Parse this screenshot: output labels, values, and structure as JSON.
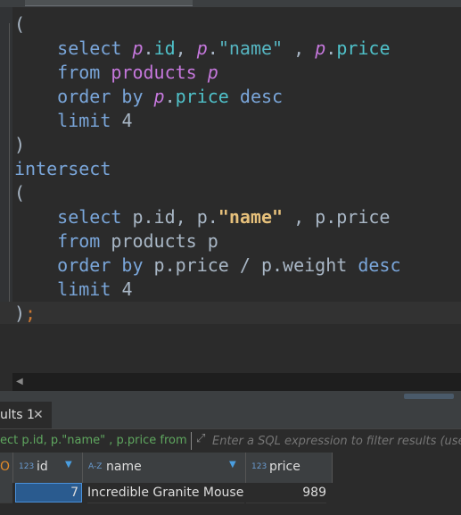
{
  "editor": {
    "lines": [
      {
        "parts": [
          [
            "plain",
            "("
          ]
        ]
      },
      {
        "parts": [
          [
            "plain",
            "    "
          ],
          [
            "kw",
            "select"
          ],
          [
            "plain",
            " "
          ],
          [
            "alias-i",
            "p"
          ],
          [
            "plain",
            "."
          ],
          [
            "fld",
            "id"
          ],
          [
            "plain",
            ", "
          ],
          [
            "alias-i",
            "p"
          ],
          [
            "plain",
            "."
          ],
          [
            "str",
            "\"name\""
          ],
          [
            "plain",
            " , "
          ],
          [
            "alias-i",
            "p"
          ],
          [
            "plain",
            "."
          ],
          [
            "fld",
            "price"
          ]
        ]
      },
      {
        "parts": [
          [
            "plain",
            "    "
          ],
          [
            "kw",
            "from"
          ],
          [
            "plain",
            " "
          ],
          [
            "tbl",
            "products"
          ],
          [
            "plain",
            " "
          ],
          [
            "alias-i",
            "p"
          ]
        ]
      },
      {
        "parts": [
          [
            "plain",
            "    "
          ],
          [
            "kw",
            "order by"
          ],
          [
            "plain",
            " "
          ],
          [
            "alias-i",
            "p"
          ],
          [
            "plain",
            "."
          ],
          [
            "fld",
            "price"
          ],
          [
            "plain",
            " "
          ],
          [
            "kw",
            "desc"
          ]
        ]
      },
      {
        "parts": [
          [
            "plain",
            "    "
          ],
          [
            "kw",
            "limit"
          ],
          [
            "plain",
            " "
          ],
          [
            "num",
            "4"
          ]
        ]
      },
      {
        "parts": [
          [
            "plain",
            ")"
          ]
        ]
      },
      {
        "parts": [
          [
            "kw",
            "intersect"
          ]
        ]
      },
      {
        "parts": [
          [
            "plain",
            "("
          ]
        ]
      },
      {
        "parts": [
          [
            "plain",
            "    "
          ],
          [
            "kw",
            "select"
          ],
          [
            "plain",
            " p.id, p."
          ],
          [
            "str2",
            "\"name\""
          ],
          [
            "plain",
            " , p.price"
          ]
        ]
      },
      {
        "parts": [
          [
            "plain",
            "    "
          ],
          [
            "kw",
            "from"
          ],
          [
            "plain",
            " products p"
          ]
        ]
      },
      {
        "parts": [
          [
            "plain",
            "    "
          ],
          [
            "kw",
            "order by"
          ],
          [
            "plain",
            " p.price / p.weight "
          ],
          [
            "kw",
            "desc"
          ]
        ]
      },
      {
        "parts": [
          [
            "plain",
            "    "
          ],
          [
            "kw",
            "limit"
          ],
          [
            "plain",
            " "
          ],
          [
            "num",
            "4"
          ]
        ]
      },
      {
        "parts": [
          [
            "plain",
            ")"
          ],
          [
            "semi",
            ";"
          ]
        ],
        "highlight": true
      }
    ]
  },
  "results": {
    "tab_label": "ults 1",
    "close_glyph": "✕",
    "filter_query_fragment": "ect p.id, p.\"name\" , p.price from",
    "filter_placeholder": "Enter a SQL expression to filter results (use C",
    "columns": [
      {
        "type": "123",
        "name": "id"
      },
      {
        "type": "A-Z",
        "name": "name"
      },
      {
        "type": "123",
        "name": "price"
      }
    ],
    "rows": [
      {
        "id": "7",
        "name": "Incredible Granite Mouse",
        "price": "989"
      }
    ]
  }
}
